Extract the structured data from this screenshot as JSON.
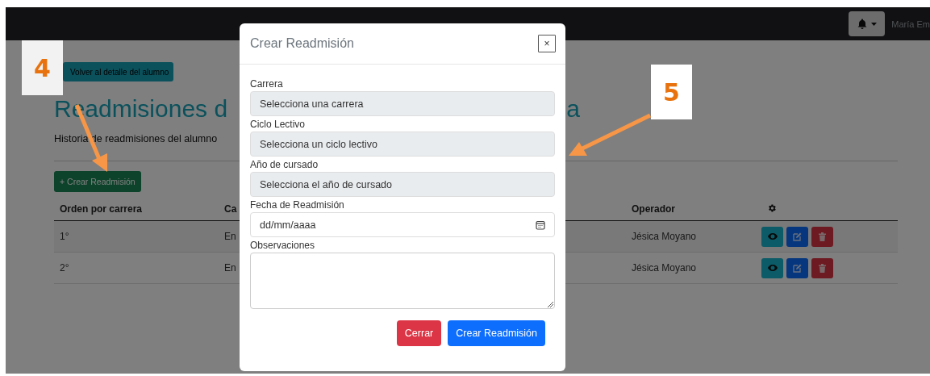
{
  "navbar": {
    "user_name": "María Em"
  },
  "back_button": "Volver al detalle del alumno",
  "title_parts": [
    "Readmisiones d",
    "a"
  ],
  "subtitle": "Historia de readmisiones del alumno",
  "create_button": "+ Crear Readmisión",
  "table": {
    "columns": [
      "Orden por carrera",
      "Ca",
      "Operador"
    ],
    "rows": [
      {
        "cells": [
          "1°",
          "En",
          "Jésica Moyano"
        ]
      },
      {
        "cells": [
          "2°",
          "En",
          "Jésica Moyano"
        ]
      }
    ]
  },
  "modal": {
    "title": "Crear Readmisión",
    "close": "×",
    "fields": [
      {
        "kind": "select",
        "label": "Carrera",
        "placeholder": "Selecciona una carrera"
      },
      {
        "kind": "select",
        "label": "Ciclo Lectivo",
        "placeholder": "Selecciona un ciclo lectivo"
      },
      {
        "kind": "select",
        "label": "Año de cursado",
        "placeholder": "Selecciona el año de cursado"
      },
      {
        "kind": "date",
        "label": "Fecha de Readmisión",
        "placeholder": "dd/mm/aaaa"
      },
      {
        "kind": "textarea",
        "label": "Observaciones"
      }
    ],
    "buttons": [
      "Cerrar",
      "Crear Readmisión"
    ]
  },
  "callouts": [
    {
      "label": "4"
    },
    {
      "label": "5"
    }
  ]
}
